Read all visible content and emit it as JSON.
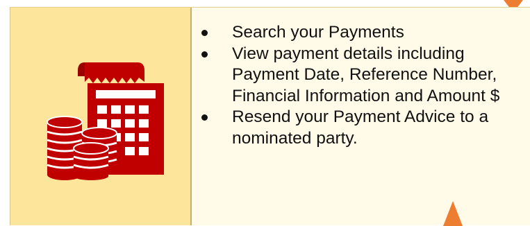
{
  "features": {
    "items": [
      {
        "text": "Search your Payments"
      },
      {
        "text": "View payment details including Payment Date, Reference Number, Financial Information and Amount $"
      },
      {
        "text": "Resend your Payment Advice to a nominated party."
      }
    ]
  },
  "icon": {
    "name": "calculator-coins-icon",
    "color": "#c00000"
  },
  "colors": {
    "left_panel": "#fde59b",
    "right_panel": "#fffbe8",
    "accent": "#ed7d31",
    "icon_red": "#c00000"
  }
}
